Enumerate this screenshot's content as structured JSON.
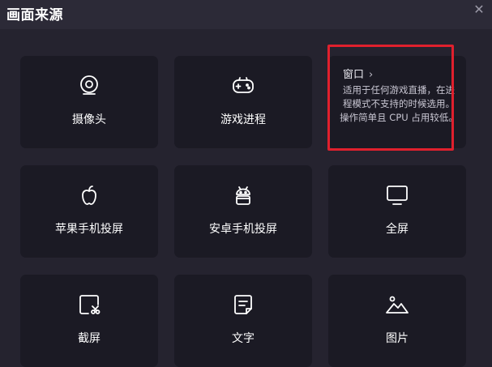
{
  "window": {
    "title": "画面来源",
    "close_glyph": "✕"
  },
  "tiles": [
    {
      "label": "摄像头",
      "icon": "webcam-icon"
    },
    {
      "label": "游戏进程",
      "icon": "gamepad-icon"
    },
    {
      "title": "窗口",
      "chevron": "›",
      "description": "适用于任何游戏直播，在进程模式不支持的时候选用。操作简单且 CPU 占用较低。",
      "highlighted": true
    },
    {
      "label": "苹果手机投屏",
      "icon": "apple-icon"
    },
    {
      "label": "安卓手机投屏",
      "icon": "android-icon"
    },
    {
      "label": "全屏",
      "icon": "monitor-icon"
    },
    {
      "label": "截屏",
      "icon": "screenshot-icon"
    },
    {
      "label": "文字",
      "icon": "text-icon"
    },
    {
      "label": "图片",
      "icon": "picture-icon"
    }
  ],
  "colors": {
    "background": "#25232f",
    "tile": "#1b1a24",
    "highlight": "#e0202d"
  }
}
